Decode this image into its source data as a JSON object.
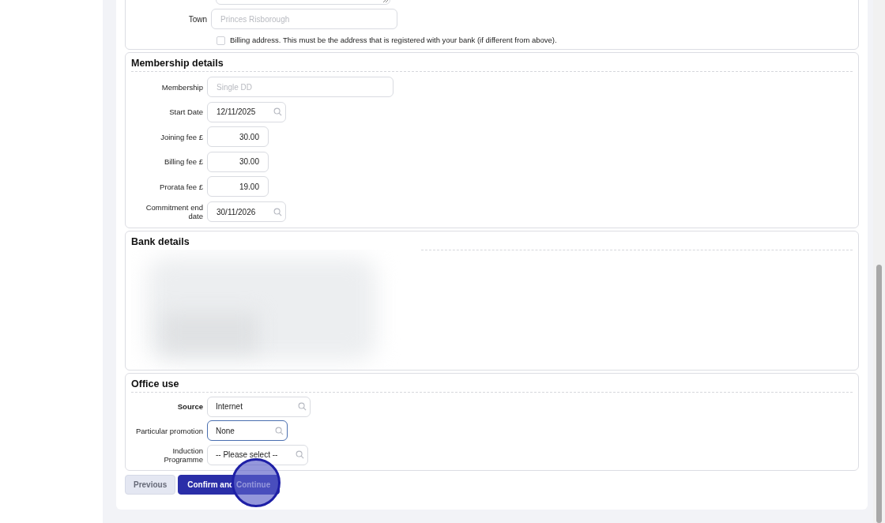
{
  "address": {
    "town": {
      "label": "Town",
      "placeholder": "Princes Risborough"
    },
    "billing_checkbox": {
      "label": "Billing address. This must be the address that is registered with your bank (if different from above).",
      "checked": false
    }
  },
  "membership_details": {
    "title": "Membership details",
    "fields": [
      {
        "label": "Membership",
        "placeholder": "Single DD",
        "kind": "wide"
      },
      {
        "label": "Start Date",
        "value": "12/11/2025",
        "kind": "lookup"
      },
      {
        "label": "Joining fee £",
        "value": "30.00",
        "kind": "amount"
      },
      {
        "label": "Billing fee £",
        "value": "30.00",
        "kind": "amount"
      },
      {
        "label": "Prorata fee £",
        "value": "19.00",
        "kind": "amount"
      },
      {
        "label": "Commitment end date",
        "value": "30/11/2026",
        "kind": "lookup"
      }
    ]
  },
  "bank_details": {
    "title": "Bank details"
  },
  "office_use": {
    "title": "Office use",
    "fields": [
      {
        "label": "Source",
        "value": "Internet",
        "emphasized": true,
        "focused": false
      },
      {
        "label": "Particular promotion",
        "value": "None",
        "emphasized": false,
        "focused": true
      },
      {
        "label": "Induction Programme",
        "value": "-- Please select --",
        "emphasized": false,
        "focused": false
      }
    ]
  },
  "buttons": [
    {
      "label": "Previous",
      "kind": "secondary"
    },
    {
      "label": "Confirm and Continue",
      "kind": "primary"
    }
  ]
}
